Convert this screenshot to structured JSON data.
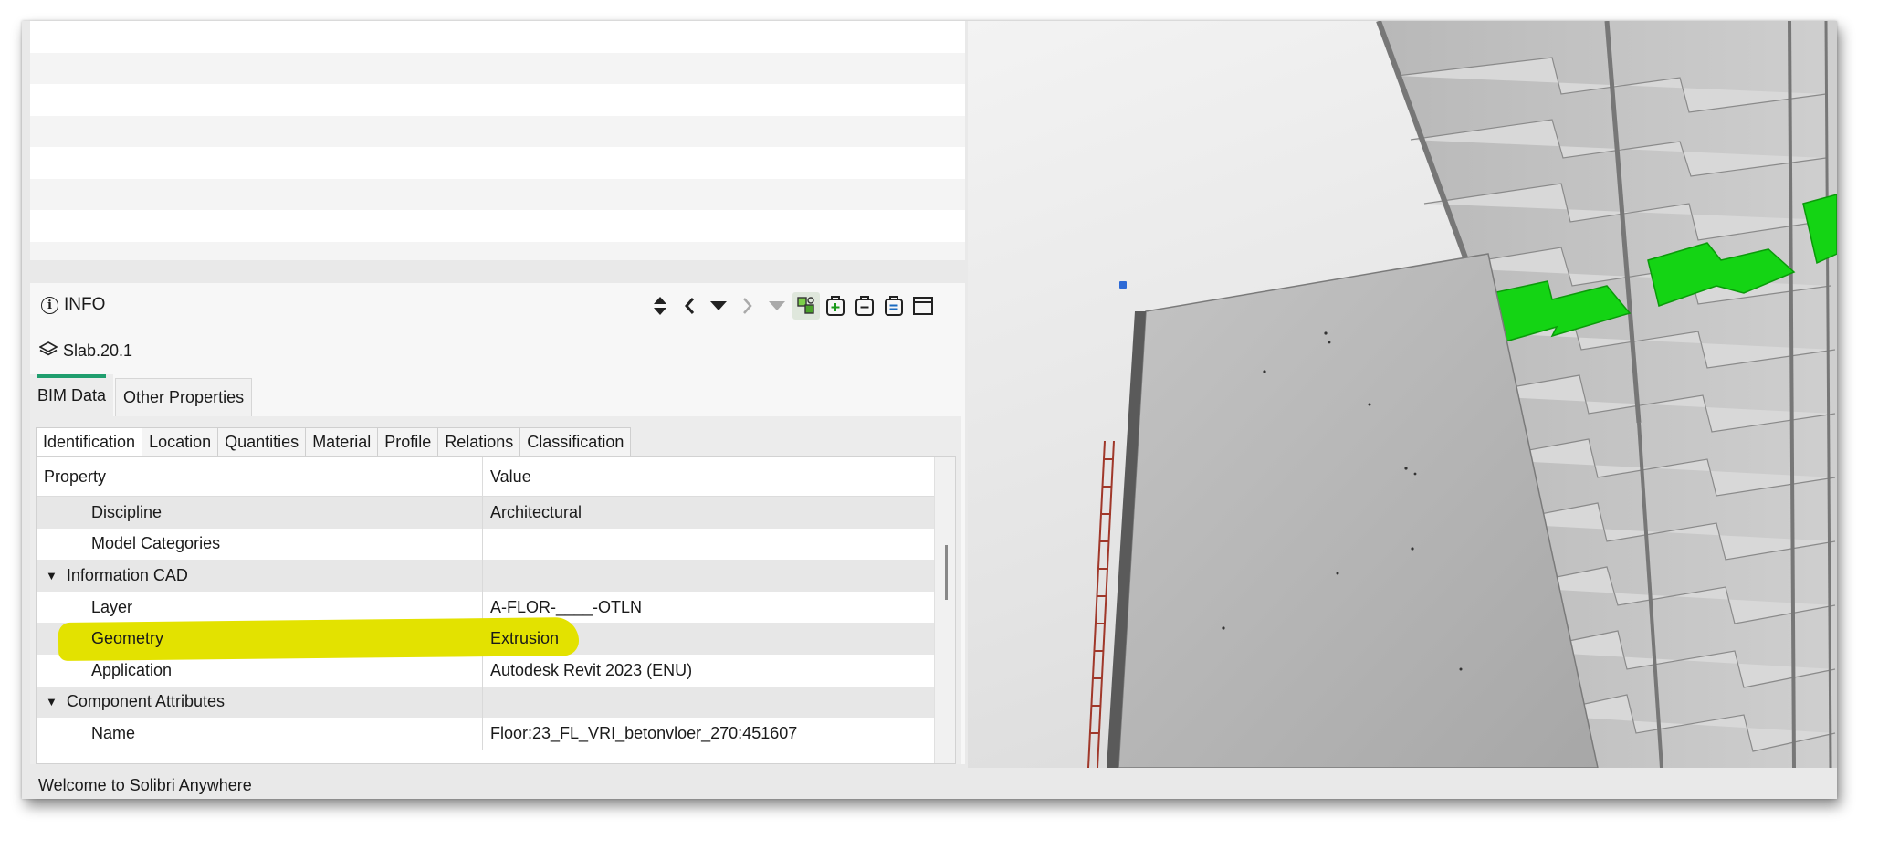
{
  "info_panel": {
    "title": "INFO",
    "selected_object": "Slab.20.1",
    "main_tabs": [
      "BIM Data",
      "Other Properties"
    ],
    "sub_tabs": [
      "Identification",
      "Location",
      "Quantities",
      "Material",
      "Profile",
      "Relations",
      "Classification"
    ],
    "table": {
      "headers": [
        "Property",
        "Value"
      ],
      "rows": [
        {
          "property": "Discipline",
          "value": "Architectural"
        },
        {
          "property": "Model Categories",
          "value": ""
        },
        {
          "property": "Information CAD",
          "value": ""
        },
        {
          "property": "Layer",
          "value": "A-FLOR-____-OTLN"
        },
        {
          "property": "Geometry",
          "value": "Extrusion"
        },
        {
          "property": "Application",
          "value": "Autodesk Revit 2023 (ENU)"
        },
        {
          "property": "Component Attributes",
          "value": ""
        },
        {
          "property": "Name",
          "value": "Floor:23_FL_VRI_betonvloer_270:451607"
        }
      ]
    }
  },
  "statusbar": {
    "text": "Welcome to Solibri Anywhere"
  },
  "colors": {
    "highlight": "#e3e200",
    "selected_geometry": "#14d414",
    "tab_accent": "#1f9e6e"
  },
  "icons": [
    "info-icon",
    "sort-arrows-icon",
    "previous-icon",
    "dropdown-icon",
    "next-icon",
    "next-dropdown-icon",
    "colorize-icon",
    "add-to-basket-icon",
    "remove-from-basket-icon",
    "set-basket-icon",
    "window-icon",
    "layers-icon"
  ]
}
